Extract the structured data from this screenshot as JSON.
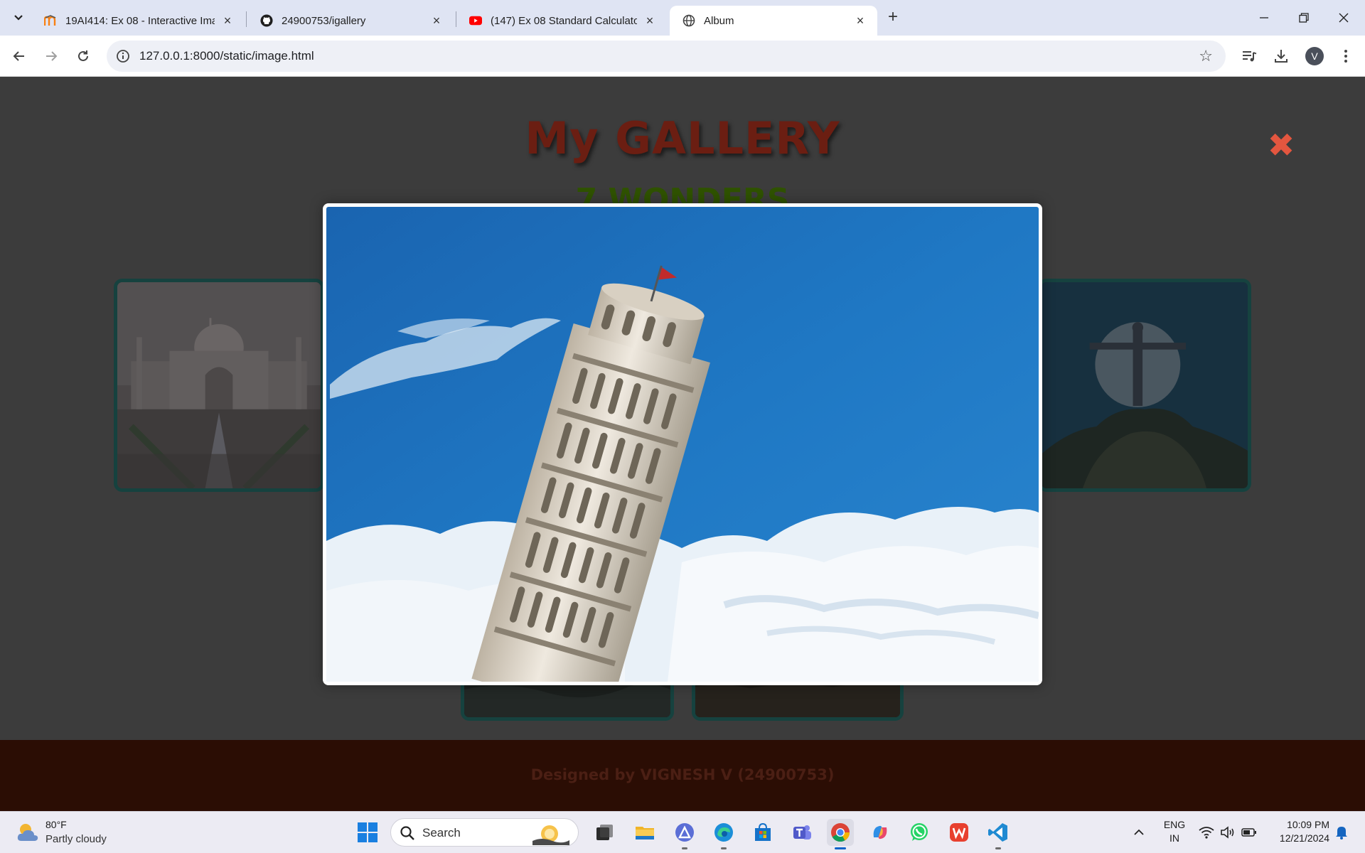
{
  "browser": {
    "tabs": [
      {
        "title": "19AI414: Ex 08 - Interactive Ima",
        "active": false
      },
      {
        "title": "24900753/igallery",
        "active": false
      },
      {
        "title": "(147) Ex 08 Standard Calculator",
        "active": false
      },
      {
        "title": "Album",
        "active": true
      }
    ],
    "url": "127.0.0.1:8000/static/image.html",
    "profile_initial": "V"
  },
  "page": {
    "title": "My GALLERY",
    "subtitle": "7 WONDERS",
    "footer": "Designed by VIGNESH V (24900753)",
    "close_glyph": "✖",
    "colors": {
      "title": "#6b1e12",
      "subtitle": "#2f5200",
      "card_border": "#16423f",
      "footer_bg": "#2b0d04",
      "close": "#e3563f"
    }
  },
  "lightbox": {
    "image": "leaning-tower-of-pisa"
  },
  "gallery_cards": [
    "taj-mahal",
    "christ-the-redeemer",
    "bottom-card-1",
    "bottom-card-2"
  ],
  "taskbar": {
    "weather": {
      "temp": "80°F",
      "desc": "Partly cloudy"
    },
    "search_label": "Search",
    "lang_line1": "ENG",
    "lang_line2": "IN",
    "time": "10:09 PM",
    "date": "12/21/2024"
  }
}
